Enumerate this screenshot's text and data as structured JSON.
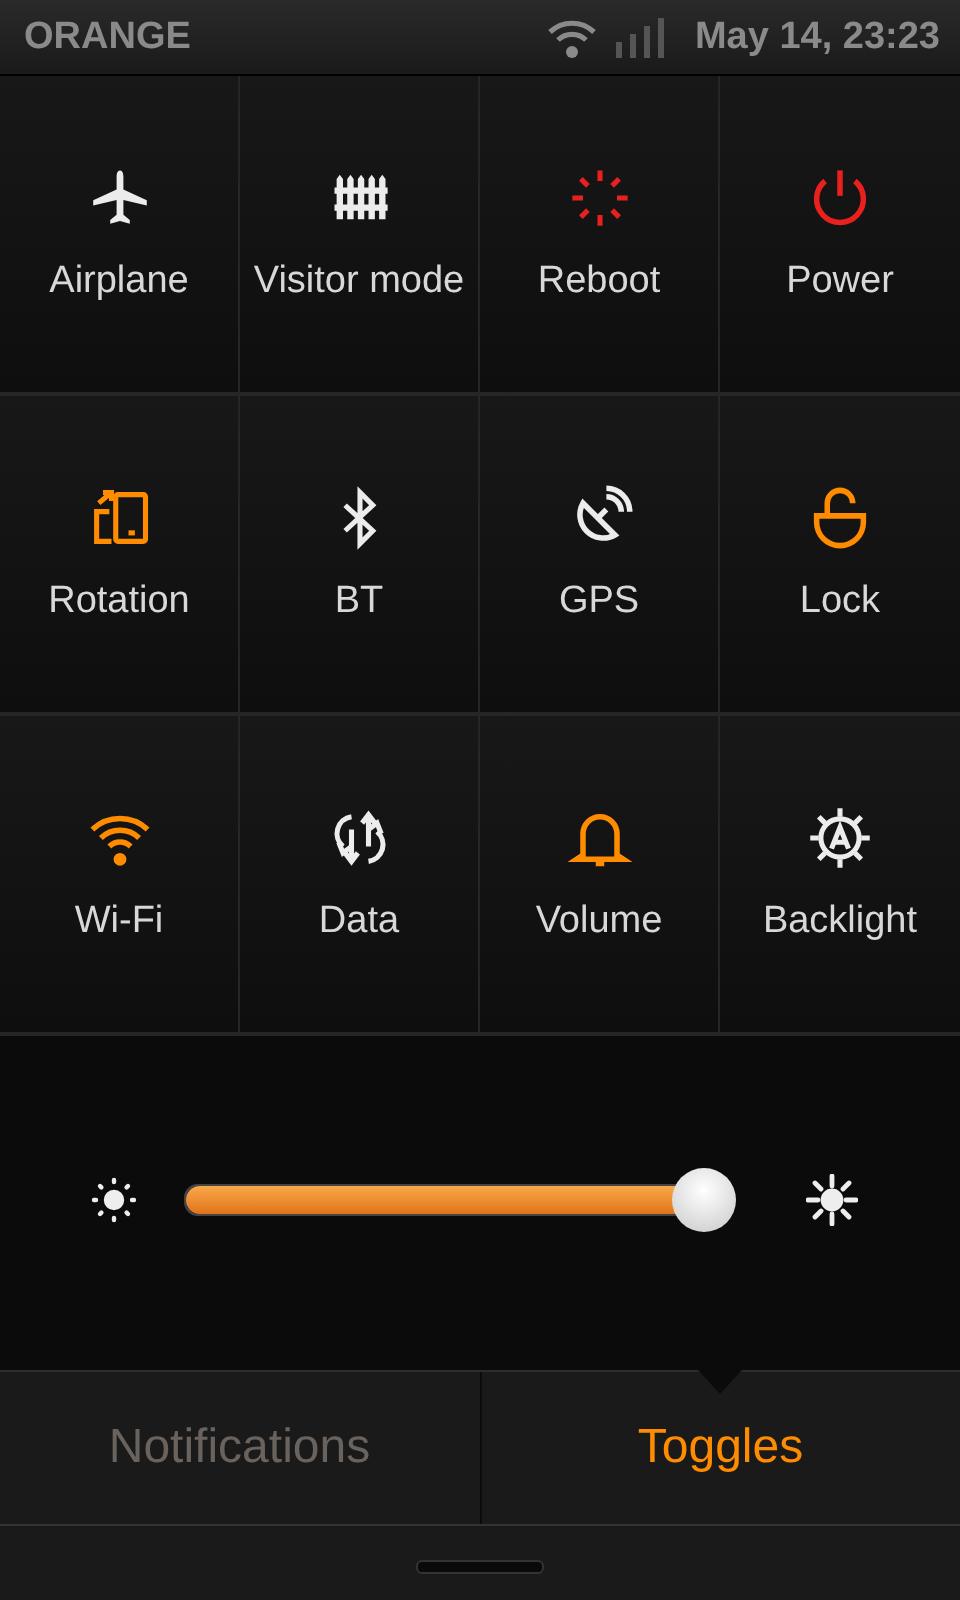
{
  "status_bar": {
    "carrier": "ORANGE",
    "datetime": "May 14, 23:23"
  },
  "toggles": [
    {
      "label": "Airplane",
      "kind": "toggle",
      "on": false
    },
    {
      "label": "Visitor mode",
      "kind": "toggle",
      "on": false
    },
    {
      "label": "Reboot",
      "kind": "action"
    },
    {
      "label": "Power",
      "kind": "action"
    },
    {
      "label": "Rotation",
      "kind": "toggle",
      "on": true
    },
    {
      "label": "BT",
      "kind": "toggle",
      "on": false
    },
    {
      "label": "GPS",
      "kind": "toggle",
      "on": false
    },
    {
      "label": "Lock",
      "kind": "toggle",
      "on": true
    },
    {
      "label": "Wi-Fi",
      "kind": "toggle",
      "on": true
    },
    {
      "label": "Data",
      "kind": "toggle",
      "on": false
    },
    {
      "label": "Volume",
      "kind": "toggle",
      "on": true
    },
    {
      "label": "Backlight",
      "kind": "toggle",
      "on": false
    }
  ],
  "brightness": {
    "level": 0.96
  },
  "tabs": [
    {
      "label": "Notifications",
      "selected": false
    },
    {
      "label": "Toggles",
      "selected": true
    }
  ]
}
